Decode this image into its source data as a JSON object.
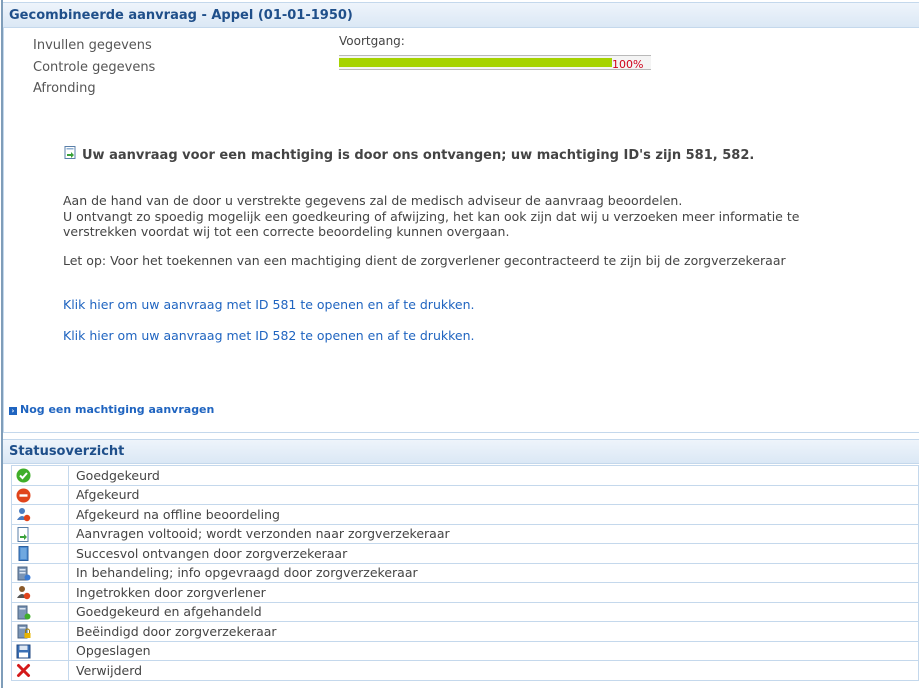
{
  "header": {
    "title": "Gecombineerde aanvraag - Appel (01-01-1950)"
  },
  "steps": [
    "Invullen gegevens",
    "Controle gegevens",
    "Afronding"
  ],
  "progress": {
    "label": "Voortgang:",
    "percent_text": "100%",
    "value": 1.0,
    "fill_color": "#a6d300"
  },
  "notice": {
    "title": "Uw aanvraag voor een machtiging is door ons ontvangen; uw machtiging ID's zijn 581, 582.",
    "paragraphs": [
      "Aan de hand van de door u verstrekte gegevens zal de medisch adviseur de aanvraag beoordelen.",
      "U ontvangt zo spoedig mogelijk een goedkeuring of afwijzing, het kan ook zijn dat wij u verzoeken meer informatie te",
      "verstrekken voordat wij tot een correcte beoordeling kunnen overgaan.",
      "Let op: Voor het toekennen van een machtiging dient de zorgverlener gecontracteerd te zijn bij de zorgverzekeraar"
    ],
    "links": [
      "Klik hier om uw aanvraag met ID 581 te openen en af te drukken.",
      "Klik hier om uw aanvraag met ID 582 te openen en af te drukken."
    ]
  },
  "more_link": "Nog een machtiging aanvragen",
  "status": {
    "title": "Statusoverzicht",
    "rows": [
      {
        "icon": "check-circle-icon",
        "label": "Goedgekeurd"
      },
      {
        "icon": "minus-circle-icon",
        "label": "Afgekeurd"
      },
      {
        "icon": "user-offline-icon",
        "label": "Afgekeurd na offline beoordeling"
      },
      {
        "icon": "document-send-icon",
        "label": "Aanvragen voltooid; wordt verzonden naar zorgverzekeraar"
      },
      {
        "icon": "door-icon",
        "label": "Succesvol ontvangen door zorgverzekeraar"
      },
      {
        "icon": "server-info-icon",
        "label": "In behandeling; info opgevraagd door zorgverzekeraar"
      },
      {
        "icon": "user-withdraw-icon",
        "label": "Ingetrokken door zorgverlener"
      },
      {
        "icon": "server-approved-icon",
        "label": "Goedgekeurd en afgehandeld"
      },
      {
        "icon": "server-locked-icon",
        "label": "Beëindigd door zorgverzekeraar"
      },
      {
        "icon": "floppy-disk-icon",
        "label": "Opgeslagen"
      },
      {
        "icon": "red-x-icon",
        "label": "Verwijderd"
      }
    ]
  }
}
